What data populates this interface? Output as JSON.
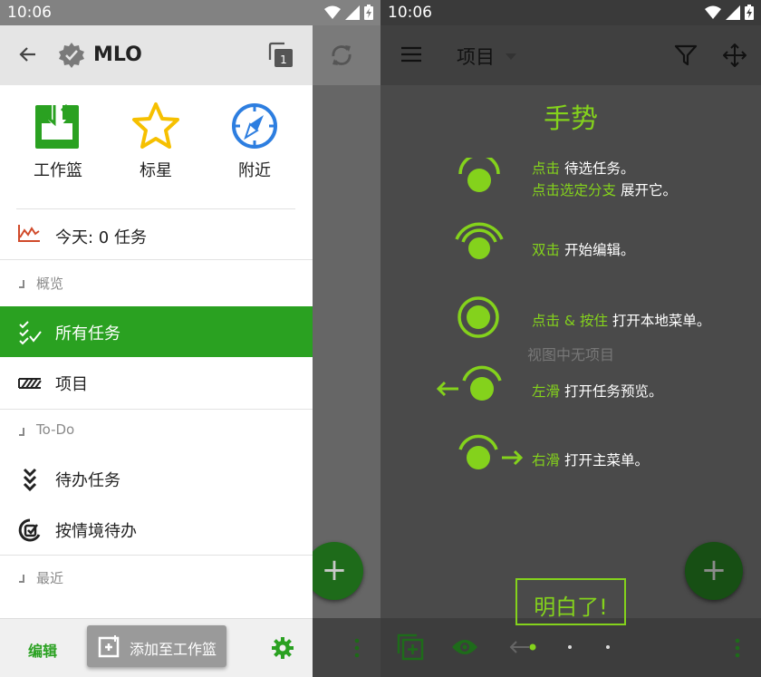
{
  "status_left": {
    "time": "10:06"
  },
  "status_right": {
    "time": "10:06"
  },
  "drawer": {
    "header": {
      "title": "MLO",
      "copy_badge": "1"
    },
    "quick": [
      {
        "label": "工作篮"
      },
      {
        "label": "标星"
      },
      {
        "label": "附近"
      }
    ],
    "today": "今天: 0 任务",
    "sections": {
      "overview": "概览",
      "todo": "To-Do",
      "recent": "最近"
    },
    "items": {
      "all_tasks": "所有任务",
      "projects": "项目",
      "todo_tasks": "待办任务",
      "context_todo": "按情境待办"
    },
    "bottom": {
      "edit": "编辑",
      "add_to_inbox": "添加至工作篮"
    }
  },
  "overlay": {
    "header_title": "项目",
    "title": "手势",
    "empty_text": "视图中无项目",
    "rows": [
      {
        "k1": "点击",
        "t1": " 待选任务。",
        "k2": "点击选定分支",
        "t2": " 展开它。"
      },
      {
        "k1": "双击",
        "t1": " 开始编辑。"
      },
      {
        "k1": "点击 & 按住",
        "t1": " 打开本地菜单。"
      },
      {
        "k1": "左滑",
        "t1": " 打开任务预览。"
      },
      {
        "k1": "右滑",
        "t1": " 打开主菜单。"
      }
    ],
    "button": "明白了!"
  },
  "colors": {
    "accent": "#2aa121",
    "gesture_green": "#84d21c"
  }
}
